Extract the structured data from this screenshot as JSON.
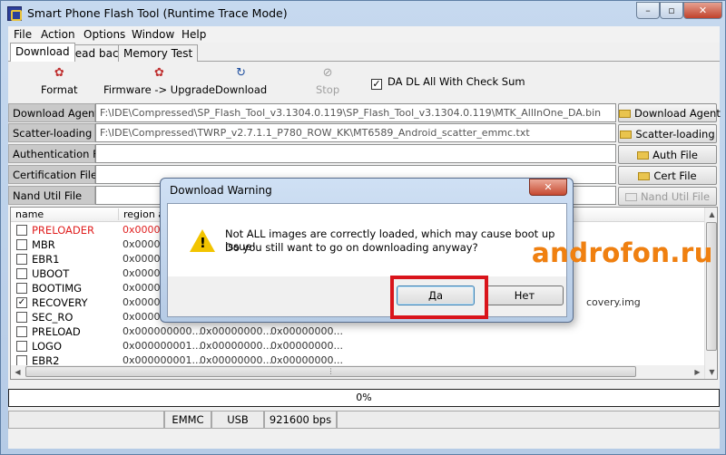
{
  "window": {
    "title": "Smart Phone Flash Tool (Runtime Trace Mode)",
    "min": "–",
    "max": "▫",
    "close": "✕"
  },
  "menu": [
    "File",
    "Action",
    "Options",
    "Window",
    "Help"
  ],
  "tabs": [
    "Download",
    "Read back",
    "Memory Test"
  ],
  "toolbar": {
    "format": "Format",
    "firmware_upgrade": "Firmware -> Upgrade",
    "download": "Download",
    "stop": "Stop",
    "da_checksum": "DA DL All With Check Sum",
    "da_checksum_checked": true
  },
  "fields": [
    {
      "label": "Download Agent",
      "value": "F:\\IDE\\Compressed\\SP_Flash_Tool_v3.1304.0.119\\SP_Flash_Tool_v3.1304.0.119\\MTK_AllInOne_DA.bin",
      "button": "Download Agent"
    },
    {
      "label": "Scatter-loading File",
      "value": "F:\\IDE\\Compressed\\TWRP_v2.7.1.1_P780_ROW_KK\\MT6589_Android_scatter_emmc.txt",
      "button": "Scatter-loading"
    },
    {
      "label": "Authentication File",
      "value": "",
      "button": "Auth File"
    },
    {
      "label": "Certification File",
      "value": "",
      "button": "Cert File"
    },
    {
      "label": "Nand Util File",
      "value": "",
      "button": "Nand Util File"
    }
  ],
  "list": {
    "headers": [
      "name",
      "region add"
    ],
    "rows": [
      {
        "name": "PRELOADER",
        "checked": false,
        "c2": "0x0000000",
        "c3": "",
        "c4": "",
        "c5": "",
        "red": true
      },
      {
        "name": "MBR",
        "checked": false,
        "c2": "0x0000000",
        "c3": "",
        "c4": "",
        "c5": ""
      },
      {
        "name": "EBR1",
        "checked": false,
        "c2": "0x0000000",
        "c3": "",
        "c4": "",
        "c5": ""
      },
      {
        "name": "UBOOT",
        "checked": false,
        "c2": "0x0000000",
        "c3": "",
        "c4": "",
        "c5": ""
      },
      {
        "name": "BOOTIMG",
        "checked": false,
        "c2": "0x0000000",
        "c3": "",
        "c4": "",
        "c5": ""
      },
      {
        "name": "RECOVERY",
        "checked": true,
        "c2": "0x0000000",
        "c3": "",
        "c4": "",
        "c5": "covery.img"
      },
      {
        "name": "SEC_RO",
        "checked": false,
        "c2": "0x0000000",
        "c3": "",
        "c4": "",
        "c5": ""
      },
      {
        "name": "PRELOAD",
        "checked": false,
        "c2": "0x000000000...",
        "c3": "0x00000000...",
        "c4": "0x00000000...",
        "c5": ""
      },
      {
        "name": "LOGO",
        "checked": false,
        "c2": "0x000000001...",
        "c3": "0x00000000...",
        "c4": "0x00000000...",
        "c5": ""
      },
      {
        "name": "EBR2",
        "checked": false,
        "c2": "0x000000001...",
        "c3": "0x00000000...",
        "c4": "0x00000000...",
        "c5": ""
      }
    ]
  },
  "progress": {
    "text": "0%",
    "value": 0
  },
  "status": [
    "",
    "EMMC",
    "USB",
    "921600 bps",
    ""
  ],
  "dialog": {
    "title": "Download Warning",
    "close": "✕",
    "line1": "Not ALL images are correctly loaded, which may cause boot up issue!",
    "line2": "Do you still want to go on downloading anyway?",
    "yes": "Да",
    "no": "Нет"
  },
  "watermark": "androfon.ru",
  "colors": {
    "highlight": "#d9141b",
    "watermark": "#f08010",
    "error_text": "#e02020"
  }
}
